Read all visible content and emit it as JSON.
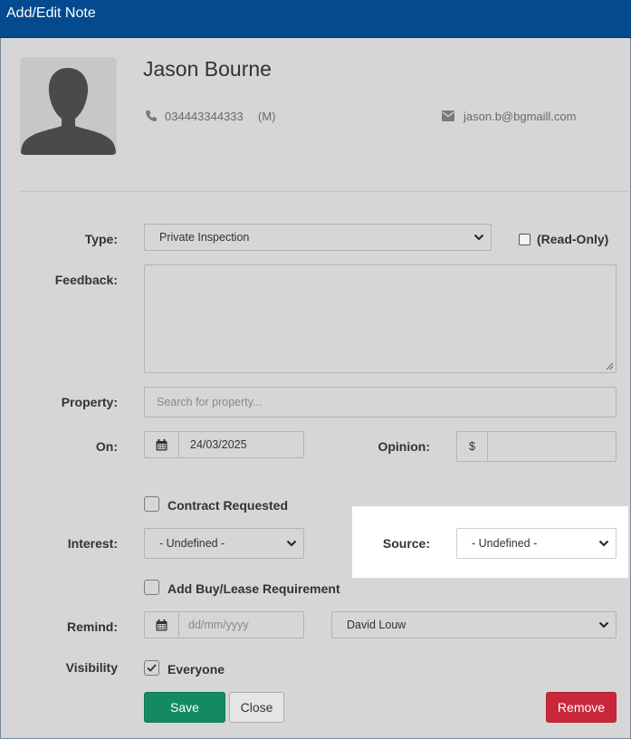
{
  "window": {
    "title": "Add/Edit Note"
  },
  "contact": {
    "name": "Jason Bourne",
    "phone": "034443344333",
    "phone_type": "(M)",
    "email": "jason.b@bgmaill.com"
  },
  "form": {
    "type": {
      "label": "Type:",
      "value": "Private Inspection"
    },
    "read_only": {
      "label": "(Read-Only)",
      "checked": false
    },
    "feedback": {
      "label": "Feedback:",
      "value": ""
    },
    "property": {
      "label": "Property:",
      "placeholder": "Search for property..."
    },
    "on": {
      "label": "On:",
      "value": "24/03/2025"
    },
    "opinion": {
      "label": "Opinion:",
      "currency": "$",
      "value": ""
    },
    "contract_requested": {
      "label": "Contract Requested",
      "checked": false
    },
    "interest": {
      "label": "Interest:",
      "value": "- Undefined -"
    },
    "source": {
      "label": "Source:",
      "value": "- Undefined -"
    },
    "buy_lease": {
      "label": "Add Buy/Lease Requirement",
      "checked": false
    },
    "remind": {
      "label": "Remind:",
      "date_placeholder": "dd/mm/yyyy",
      "agent": "David Louw"
    },
    "visibility": {
      "label": "Visibility",
      "option_label": "Everyone",
      "checked": true
    }
  },
  "buttons": {
    "save": "Save",
    "close": "Close",
    "remove": "Remove"
  },
  "colors": {
    "titlebar": "#034a8e",
    "save": "#138a63",
    "remove": "#c9283a",
    "highlight": "#ffffff"
  },
  "icons": [
    "user-silhouette-icon",
    "phone-icon",
    "envelope-icon",
    "calendar-icon",
    "chevron-down-icon",
    "checkmark-icon"
  ]
}
